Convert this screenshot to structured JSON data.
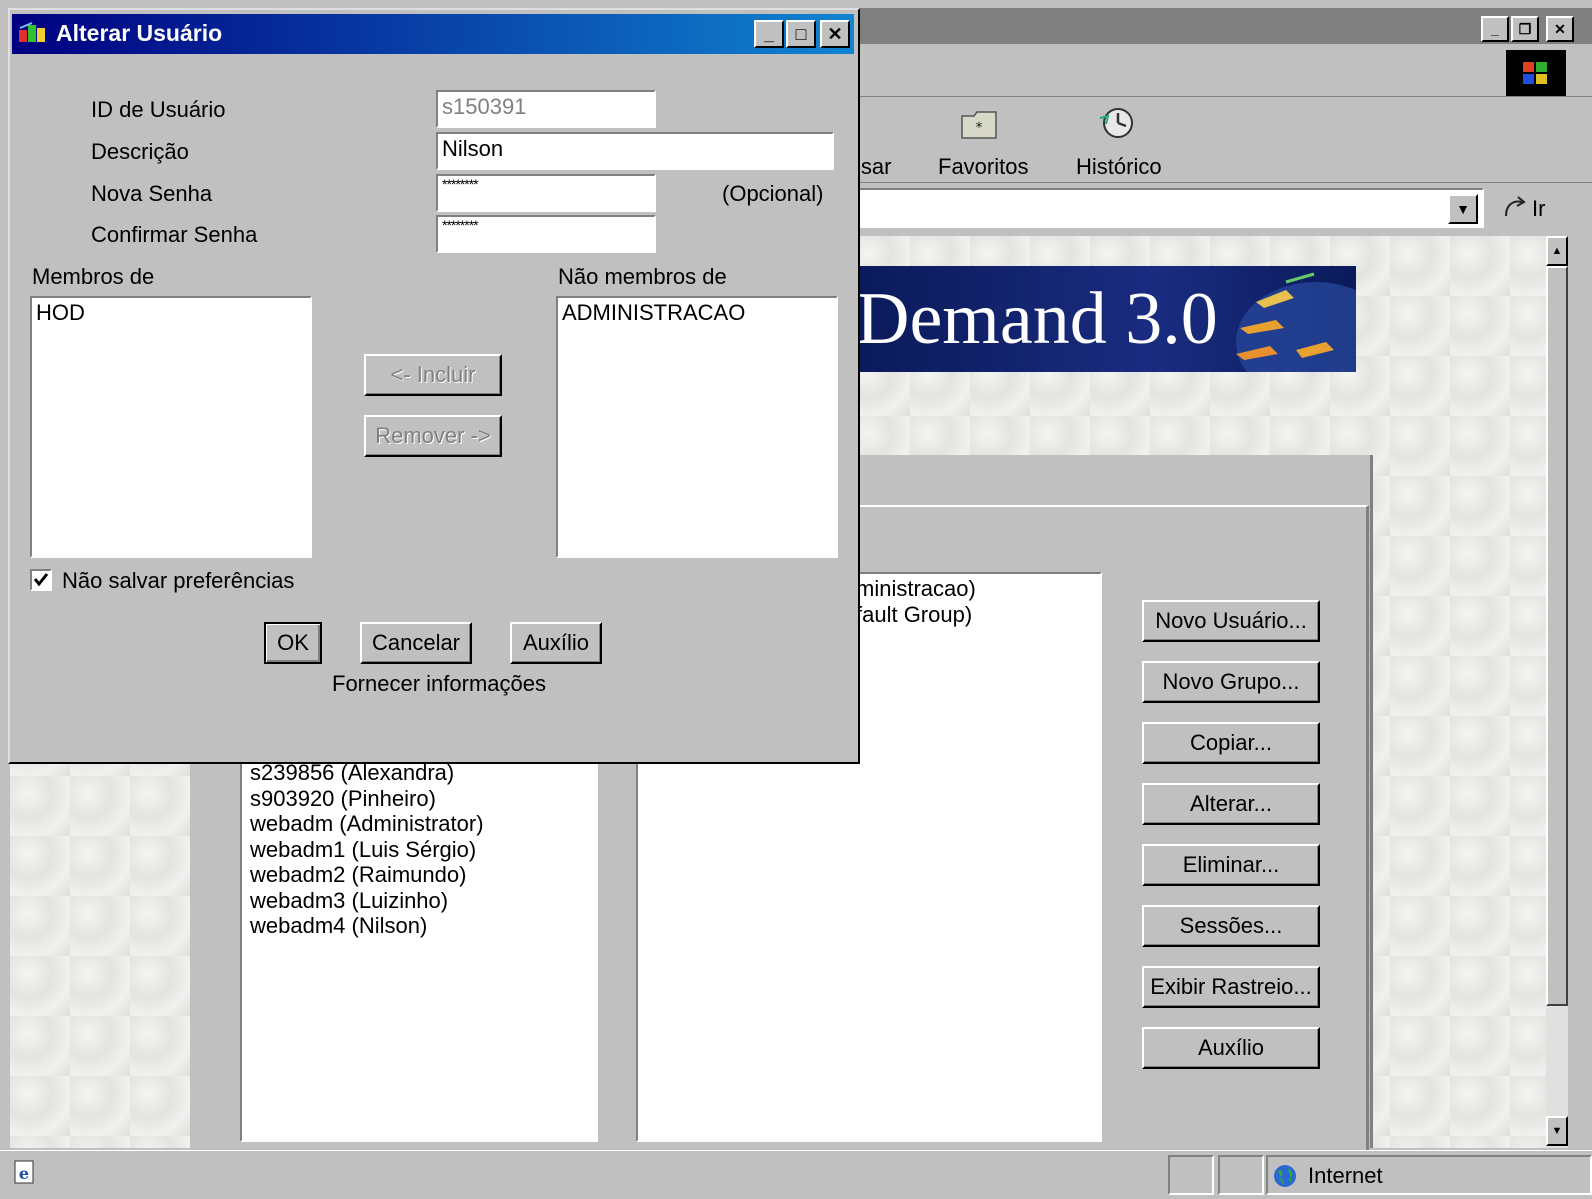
{
  "browser": {
    "toolbar": {
      "search_partial": "isar",
      "favorites": "Favoritos",
      "history": "Histórico"
    },
    "go_label": "Ir",
    "banner_text": "Demand 3.0",
    "status_zone": "Internet"
  },
  "admin": {
    "users_list": [
      "s239856 (Alexandra)",
      "s903920 (Pinheiro)",
      "webadm (Administrator)",
      "webadm1 (Luis Sérgio)",
      "webadm2 (Raimundo)",
      "webadm3 (Luizinho)",
      "webadm4 (Nilson)"
    ],
    "groups_list_partial": [
      "ministracao)",
      "fault Group)"
    ],
    "buttons": {
      "new_user": "Novo Usuário...",
      "new_group": "Novo Grupo...",
      "copy": "Copiar...",
      "change": "Alterar...",
      "delete": "Eliminar...",
      "sessions": "Sessões...",
      "trace": "Exibir Rastreio...",
      "help": "Auxílio"
    }
  },
  "dialog": {
    "title": "Alterar Usuário",
    "labels": {
      "user_id": "ID de Usuário",
      "description": "Descrição",
      "new_password": "Nova Senha",
      "confirm_password": "Confirmar Senha",
      "optional": "(Opcional)",
      "members_of": "Membros de",
      "not_members_of": "Não membros de",
      "dont_save": "Não salvar preferências",
      "footer": "Fornecer informações"
    },
    "values": {
      "user_id": "s150391",
      "description": "Nilson",
      "new_password": "********",
      "confirm_password": "********"
    },
    "members": [
      "HOD"
    ],
    "non_members": [
      "ADMINISTRACAO"
    ],
    "include_button": "<- Incluir",
    "remove_button": "Remover ->",
    "ok": "OK",
    "cancel": "Cancelar",
    "help": "Auxílio",
    "dont_save_checked": true
  }
}
